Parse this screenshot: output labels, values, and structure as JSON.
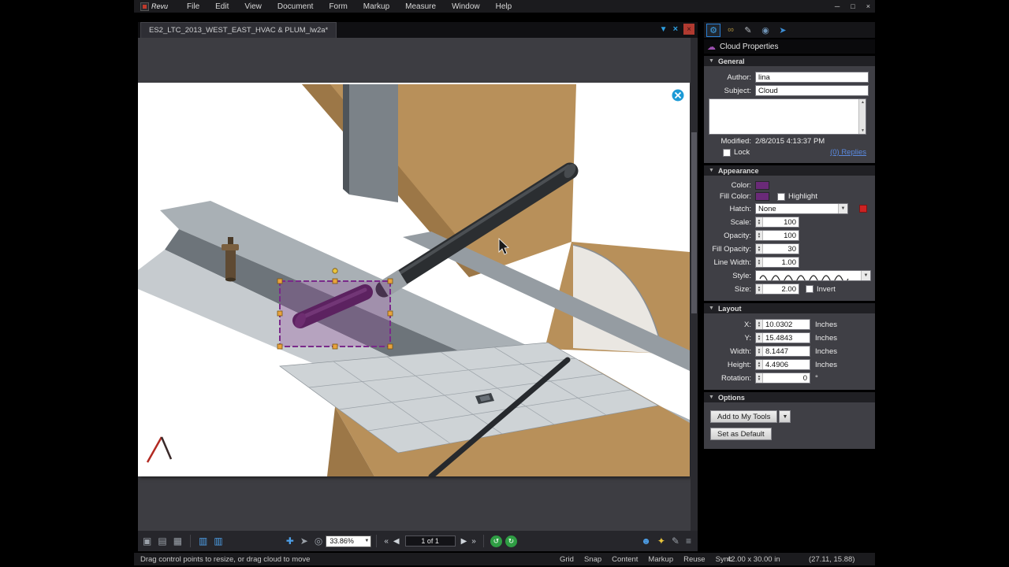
{
  "menubar": {
    "items": [
      "File",
      "Edit",
      "View",
      "Document",
      "Form",
      "Markup",
      "Measure",
      "Window",
      "Help"
    ]
  },
  "window_controls": {
    "minimize": "─",
    "maximize": "□",
    "close": "×"
  },
  "tab": {
    "title": "ES2_LTC_2013_WEST_EAST_HVAC & PLUM_lw2a*"
  },
  "panel": {
    "title": "Cloud Properties",
    "general": {
      "label": "General",
      "author_label": "Author:",
      "author_value": "lina",
      "subject_label": "Subject:",
      "subject_value": "Cloud",
      "modified_label": "Modified:",
      "modified_value": "2/8/2015 4:13:37 PM",
      "lock_label": "Lock",
      "replies_link": "(0) Replies"
    },
    "appearance": {
      "label": "Appearance",
      "color_label": "Color:",
      "fill_color_label": "Fill Color:",
      "highlight_label": "Highlight",
      "hatch_label": "Hatch:",
      "hatch_value": "None",
      "scale_label": "Scale:",
      "scale_value": "100",
      "opacity_label": "Opacity:",
      "opacity_value": "100",
      "fill_opacity_label": "Fill Opacity:",
      "fill_opacity_value": "30",
      "line_width_label": "Line Width:",
      "line_width_value": "1.00",
      "style_label": "Style:",
      "size_label": "Size:",
      "size_value": "2.00",
      "invert_label": "Invert"
    },
    "layout": {
      "label": "Layout",
      "x_label": "X:",
      "x_value": "10.0302",
      "x_unit": "Inches",
      "y_label": "Y:",
      "y_value": "15.4843",
      "y_unit": "Inches",
      "width_label": "Width:",
      "width_value": "8.1447",
      "width_unit": "Inches",
      "height_label": "Height:",
      "height_value": "4.4906",
      "height_unit": "Inches",
      "rotation_label": "Rotation:",
      "rotation_value": "0",
      "rotation_unit": "°"
    },
    "options": {
      "label": "Options",
      "add_to_my_tools": "Add to My Tools",
      "set_as_default": "Set as Default"
    }
  },
  "toolbar": {
    "zoom_value": "33.86%",
    "page_indicator": "1 of 1"
  },
  "statusbar": {
    "hint": "Drag control points to resize, or drag cloud to move",
    "toggles": [
      "Grid",
      "Snap",
      "Content",
      "Markup",
      "Reuse",
      "Sync"
    ],
    "page_size": "42.00 x 30.00 in",
    "coordinates": "(27.11, 15.88)"
  },
  "icons": {
    "gear": "⚙",
    "binoculars": "∞",
    "pencil": "✎",
    "globe": "◉",
    "megaphone": "➤",
    "cloud": "☁",
    "filter": "▼",
    "blue_x": "×",
    "doc_close": "×",
    "doc1": "▣",
    "doc2": "▤",
    "doc3": "▦",
    "panel1": "▥",
    "panel2": "▥",
    "pan": "✚",
    "select": "➤",
    "zoom": "◎",
    "nav_first": "«",
    "nav_prev": "◀",
    "nav_next": "▶",
    "nav_last": "»",
    "undo_view": "↺",
    "redo_view": "↻",
    "person": "☻",
    "bulb": "✦",
    "markup_pen": "✎",
    "stack": "≡",
    "up": "▲",
    "down": "▼",
    "dropdown": "▼",
    "tri": "▼"
  },
  "colors": {
    "markup_purple": "#8a3b96",
    "markup_fill": "#6a2a78",
    "handle_orange": "#e8a33d",
    "accent_blue": "#2e9fe0",
    "swatch_red": "#cc2222"
  }
}
